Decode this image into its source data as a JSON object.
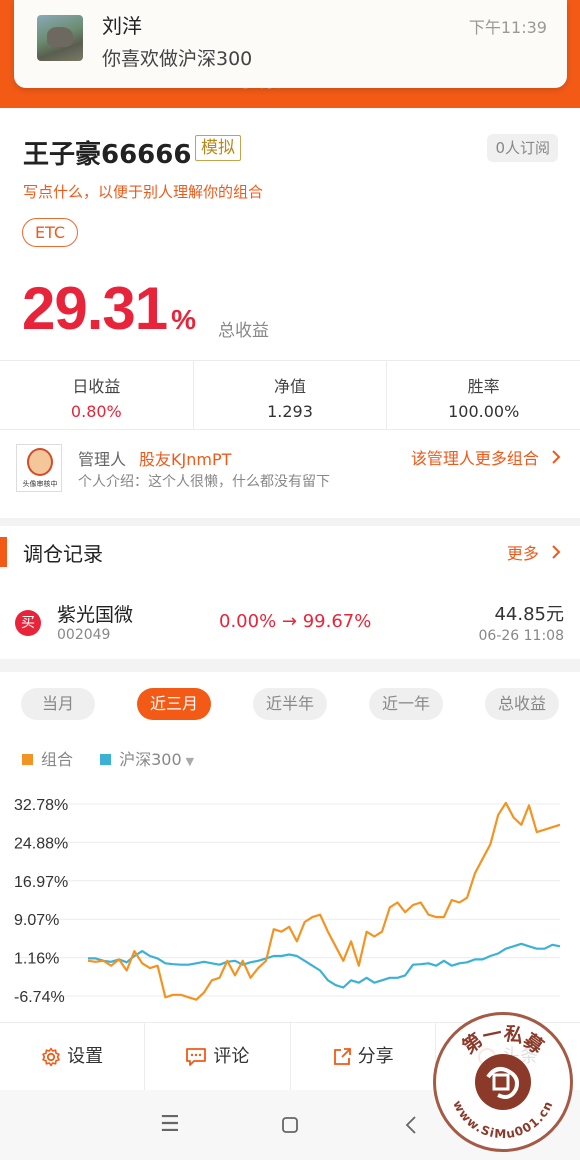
{
  "notification": {
    "name": "刘洋",
    "message": "你喜欢做沪深300",
    "time": "下午11:39"
  },
  "header": {
    "ghost_text": "王子豪66666"
  },
  "portfolio": {
    "title": "王子豪66666",
    "tag": "模拟",
    "subscribers": "0人订阅",
    "description": "写点什么，以便于别人理解你的组合",
    "category": "ETC",
    "total_return_value": "29.31",
    "total_return_unit": "%",
    "total_return_label": "总收益",
    "stats": [
      {
        "label": "日收益",
        "value": "0.80%"
      },
      {
        "label": "净值",
        "value": "1.293"
      },
      {
        "label": "胜率",
        "value": "100.00%"
      }
    ]
  },
  "manager": {
    "avatar_caption": "头像审核中",
    "label": "管理人",
    "name": "股友KJnmPT",
    "intro": "个人介绍：这个人很懒，什么都没有留下",
    "more_link": "该管理人更多组合"
  },
  "trade_record": {
    "title": "调仓记录",
    "more": "更多",
    "items": [
      {
        "action": "买",
        "name": "紫光国微",
        "code": "002049",
        "change": "0.00% → 99.67%",
        "price": "44.85元",
        "datetime": "06-26  11:08"
      }
    ]
  },
  "chart_tabs": [
    "当月",
    "近三月",
    "近半年",
    "近一年",
    "总收益"
  ],
  "chart_tab_active": 1,
  "legend": {
    "series1": "组合",
    "series2": "沪深300"
  },
  "colors": {
    "accent": "#f25a16",
    "red": "#e8243a",
    "portfolio_line": "#f39422",
    "index_line": "#3bb1d6"
  },
  "chart_data": {
    "type": "line",
    "yticks": [
      "32.78%",
      "24.88%",
      "16.97%",
      "9.07%",
      "1.16%",
      "-6.74%"
    ],
    "ylim": [
      -6.74,
      32.78
    ],
    "grid": true,
    "legend_position": "top-left",
    "series": [
      {
        "name": "组合",
        "values": [
          0.5,
          0.3,
          0.5,
          -0.5,
          0.8,
          -1.5,
          2.5,
          0.0,
          -1.0,
          -0.5,
          -7.0,
          -6.5,
          -6.5,
          -7.0,
          -7.5,
          -6.0,
          -3.5,
          -3.0,
          0.5,
          -2.5,
          0.5,
          -3.0,
          -1.0,
          0.5,
          7.0,
          6.5,
          7.5,
          4.5,
          8.5,
          9.5,
          10.0,
          6.5,
          3.5,
          0.5,
          4.5,
          -0.5,
          6.5,
          5.5,
          6.5,
          11.5,
          12.5,
          10.5,
          12.0,
          12.5,
          10.0,
          9.5,
          9.5,
          13.0,
          12.5,
          13.5,
          18.5,
          21.5,
          24.5,
          30.5,
          33.0,
          30.0,
          28.5,
          32.5,
          27.0,
          27.5,
          28.0,
          28.5
        ]
      },
      {
        "name": "沪深300",
        "values": [
          1.0,
          1.0,
          0.5,
          0.3,
          0.8,
          0.2,
          1.5,
          2.5,
          1.5,
          1.0,
          0.0,
          -0.2,
          -0.3,
          -0.3,
          0.0,
          0.3,
          0.0,
          -0.3,
          0.3,
          0.5,
          -0.3,
          0.2,
          0.5,
          1.0,
          1.5,
          1.5,
          1.8,
          1.5,
          0.5,
          -0.5,
          -1.5,
          -3.5,
          -4.5,
          -5.0,
          -3.5,
          -4.0,
          -3.0,
          -4.0,
          -3.5,
          -3.0,
          -3.0,
          -2.5,
          -0.3,
          -0.2,
          0.0,
          -0.5,
          0.5,
          -0.5,
          0.0,
          0.2,
          0.8,
          0.8,
          1.5,
          2.0,
          3.0,
          3.5,
          4.0,
          3.5,
          3.0,
          3.0,
          3.8,
          3.5
        ]
      }
    ]
  },
  "actions": [
    {
      "label": "设置",
      "icon": "gear-icon"
    },
    {
      "label": "评论",
      "icon": "comment-icon"
    },
    {
      "label": "分享",
      "icon": "share-icon"
    },
    {
      "label": "头条",
      "icon": "headline-icon"
    }
  ],
  "watermark": {
    "text_top": "第一私募",
    "text_bottom": "www.SiMu001.cn"
  }
}
